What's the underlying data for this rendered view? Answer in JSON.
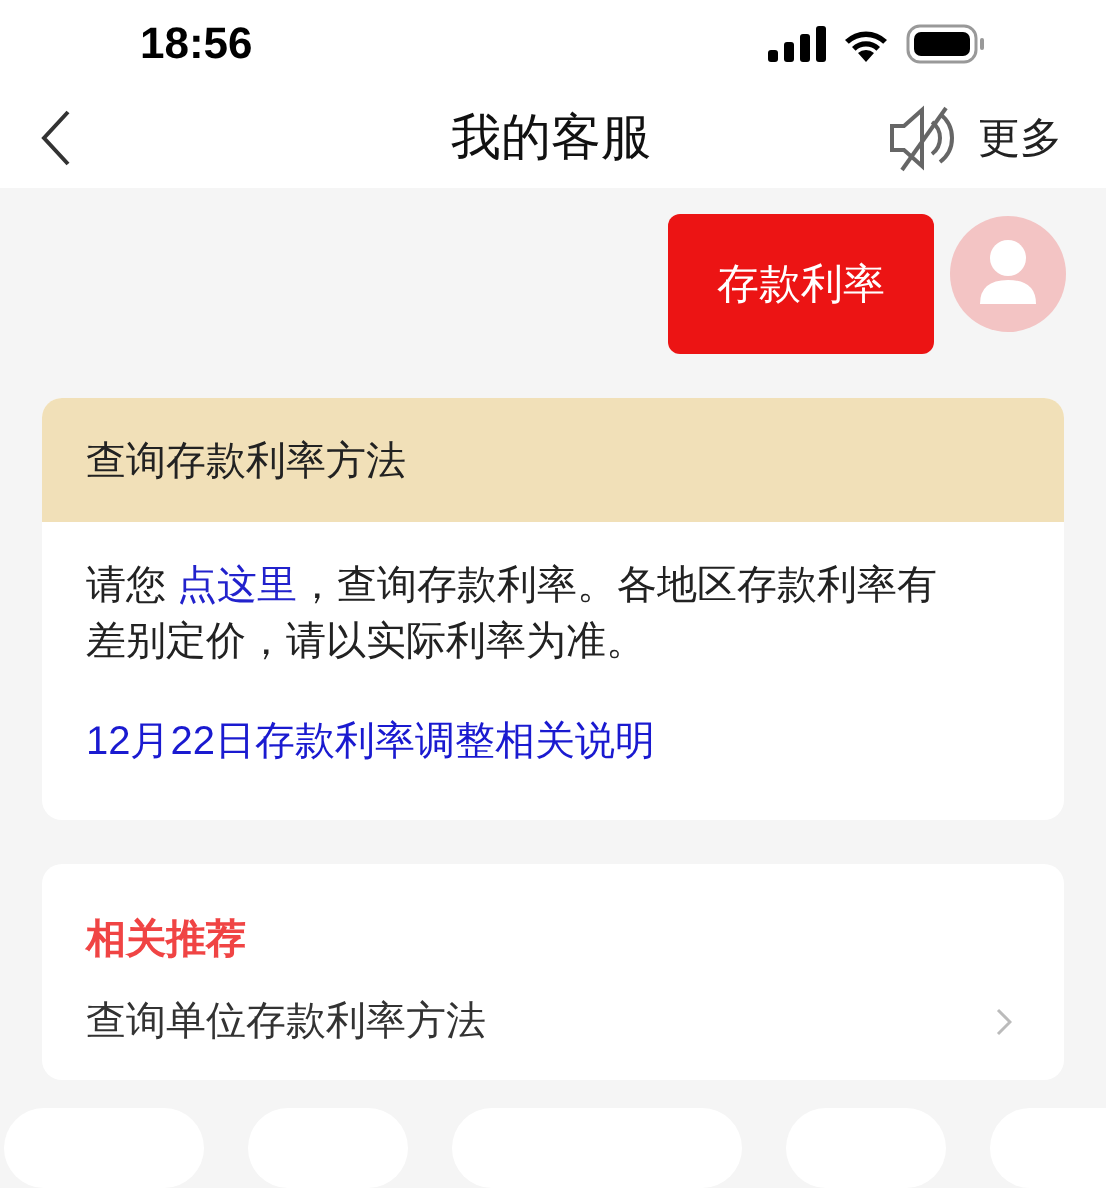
{
  "status_bar": {
    "time": "18:56"
  },
  "nav_bar": {
    "title": "我的客服",
    "muted": true,
    "more": "更多"
  },
  "messages": [
    {
      "kind": "user",
      "text": "存款利率"
    },
    {
      "kind": "card",
      "title": "查询存款利率方法",
      "body_before": "请您",
      "link": "点这里",
      "body_after": "，查询存款利率。各地区存款利率有差别定价，请以实际利率为准。",
      "note_link": "12月22日存款利率调整相关说明"
    },
    {
      "kind": "recommend",
      "heading": "相关推荐",
      "items": [
        "查询单位存款利率方法"
      ]
    }
  ],
  "quick_replies": [
    {
      "kind": "chip"
    },
    {
      "kind": "chip"
    },
    {
      "kind": "chip"
    },
    {
      "kind": "chip"
    },
    {
      "kind": "chip"
    }
  ]
}
